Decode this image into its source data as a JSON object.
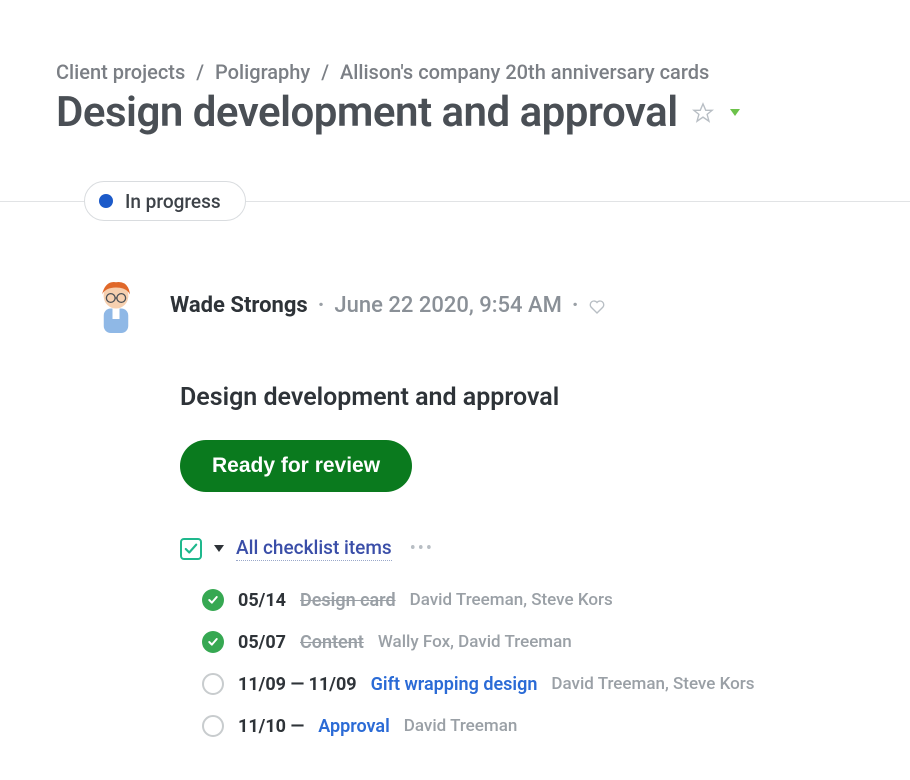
{
  "breadcrumb": {
    "l1": "Client projects",
    "l2": "Poligraphy",
    "l3": "Allison's company 20th anniversary cards"
  },
  "title": "Design development and approval",
  "status": {
    "label": "In progress",
    "color": "#1c5ac9"
  },
  "post": {
    "author": "Wade Strongs",
    "timestamp": "June 22 2020, 9:54 AM",
    "body_title": "Design development and approval",
    "action_label": "Ready for review"
  },
  "checklist": {
    "title": "All checklist items",
    "items": [
      {
        "done": true,
        "date": "05/14",
        "title": "Design card",
        "assignees": "David Treeman, Steve Kors"
      },
      {
        "done": true,
        "date": "05/07",
        "title": "Content",
        "assignees": "Wally Fox, David Treeman"
      },
      {
        "done": false,
        "date": "11/09 — 11/09",
        "title": "Gift wrapping design",
        "assignees": "David Treeman, Steve Kors"
      },
      {
        "done": false,
        "date": "11/10 —",
        "title": "Approval",
        "assignees": "David Treeman"
      }
    ]
  }
}
